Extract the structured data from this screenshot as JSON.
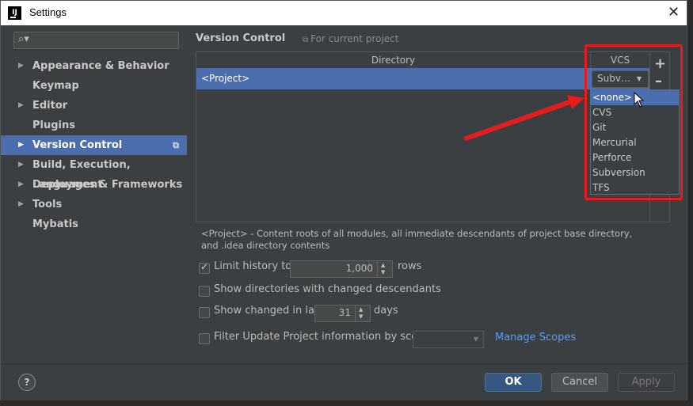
{
  "window": {
    "title": "Settings",
    "logo_text": "IJ"
  },
  "search": {
    "placeholder": ""
  },
  "tree": {
    "items": [
      {
        "label": "Appearance & Behavior",
        "expandable": true
      },
      {
        "label": "Keymap",
        "expandable": false
      },
      {
        "label": "Editor",
        "expandable": true
      },
      {
        "label": "Plugins",
        "expandable": false
      },
      {
        "label": "Version Control",
        "expandable": true,
        "selected": true
      },
      {
        "label": "Build, Execution, Deployment",
        "expandable": true
      },
      {
        "label": "Languages & Frameworks",
        "expandable": true
      },
      {
        "label": "Tools",
        "expandable": true
      },
      {
        "label": "Mybatis",
        "expandable": false
      }
    ]
  },
  "content": {
    "title": "Version Control",
    "scope_hint": "For current project",
    "table": {
      "headers": {
        "directory": "Directory",
        "vcs": "VCS"
      },
      "rows": [
        {
          "directory": "<Project>",
          "vcs": "Subv…"
        }
      ]
    },
    "vcs_options": [
      "<none>",
      "CVS",
      "Git",
      "Mercurial",
      "Perforce",
      "Subversion",
      "TFS"
    ],
    "vcs_highlighted": "<none>",
    "description": "<Project> - Content roots of all modules, all immediate descendants of project base directory, and .idea directory contents",
    "limit_history": {
      "label": "Limit history to:",
      "checked": true,
      "value": "1,000",
      "suffix": "rows"
    },
    "show_dirs": {
      "label": "Show directories with changed descendants",
      "checked": false
    },
    "show_changed": {
      "label": "Show changed in last",
      "checked": false,
      "value": "31",
      "suffix": "days"
    },
    "filter_update": {
      "label": "Filter Update Project information by scope",
      "checked": false,
      "scope_value": "",
      "link": "Manage Scopes"
    }
  },
  "buttons": {
    "help": "?",
    "ok": "OK",
    "cancel": "Cancel",
    "apply": "Apply"
  },
  "colors": {
    "selection": "#4b6eaf",
    "annotation": "#e81c1c",
    "link": "#589df6"
  }
}
